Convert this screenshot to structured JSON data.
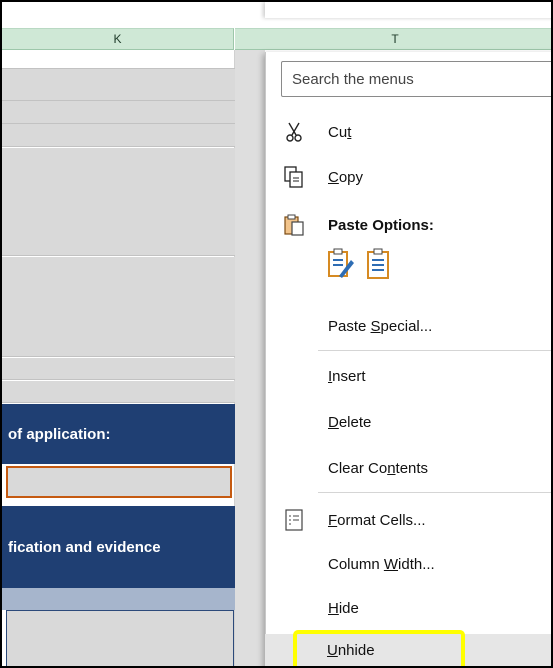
{
  "column_headers": {
    "k": "K",
    "t": "T"
  },
  "sheet": {
    "band_1_text": "of application:",
    "band_2_text": "fication and evidence"
  },
  "menu": {
    "search_placeholder": "Search the menus",
    "items": {
      "cut": {
        "label_pre": "Cu",
        "label_ul": "t",
        "label_post": ""
      },
      "copy": {
        "label_pre": "",
        "label_ul": "C",
        "label_post": "opy"
      },
      "paste_options": {
        "label": "Paste Options:"
      },
      "paste_special": {
        "label_pre": "Paste ",
        "label_ul": "S",
        "label_post": "pecial..."
      },
      "insert": {
        "label_pre": "",
        "label_ul": "I",
        "label_post": "nsert"
      },
      "delete": {
        "label_pre": "",
        "label_ul": "D",
        "label_post": "elete"
      },
      "clear_contents": {
        "label_pre": "Clear Co",
        "label_ul": "n",
        "label_post": "tents"
      },
      "format_cells": {
        "label_pre": "",
        "label_ul": "F",
        "label_post": "ormat Cells..."
      },
      "column_width": {
        "label_pre": "Column ",
        "label_ul": "W",
        "label_post": "idth..."
      },
      "hide": {
        "label_pre": "",
        "label_ul": "H",
        "label_post": "ide"
      },
      "unhide": {
        "label_pre": "",
        "label_ul": "U",
        "label_post": "nhide"
      }
    }
  },
  "icons": {
    "cut": "scissors-icon",
    "copy": "copy-icon",
    "paste_options": "clipboard-icon",
    "paste_format": "paste-formatting-icon",
    "paste_values": "paste-clipboard-icon",
    "format_cells": "format-cells-icon"
  },
  "colors": {
    "header_green": "#cfe8d6",
    "band_blue": "#1f3f73",
    "input_border_orange": "#c55a11",
    "highlight_yellow": "#ffff00"
  }
}
